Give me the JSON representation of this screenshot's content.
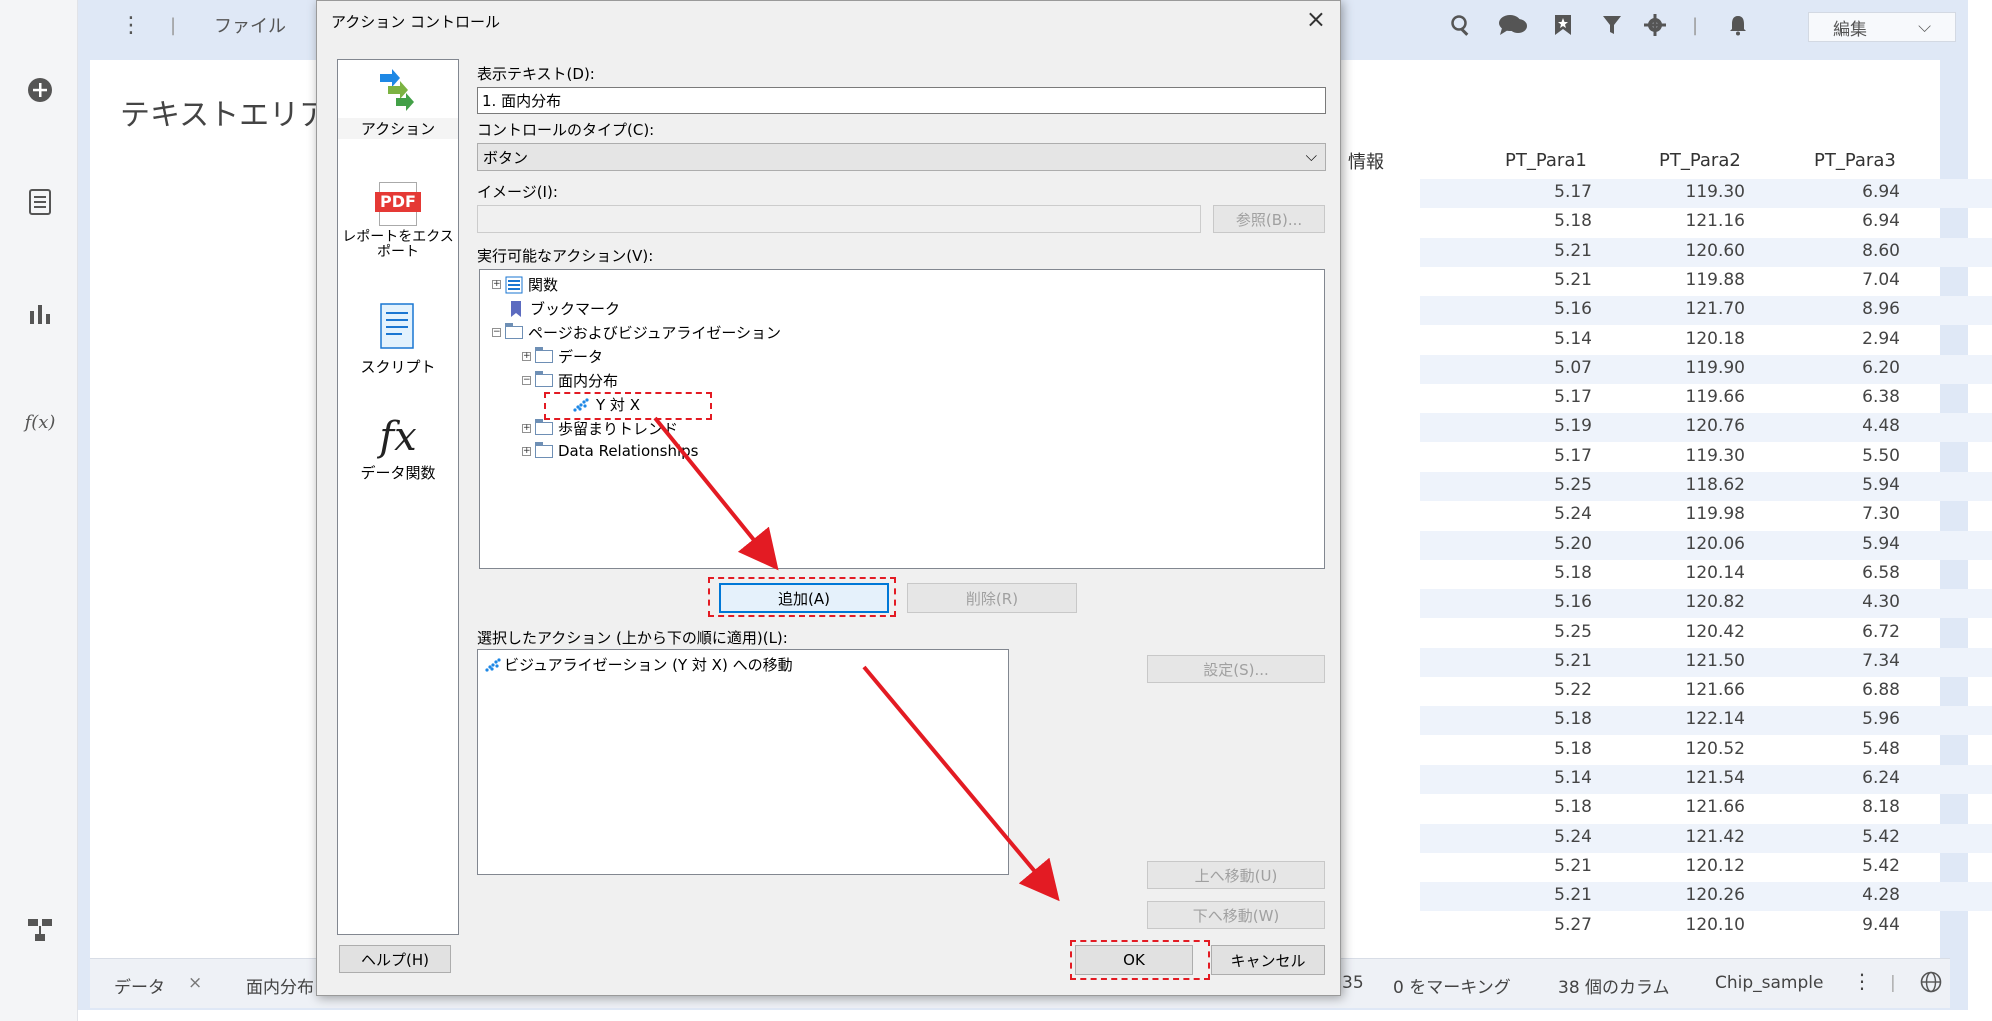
{
  "app": {
    "topbar": {
      "file_menu": "ファイル",
      "edit_select": "編集"
    },
    "content_title": "テキストエリア",
    "table": {
      "partial_header": "情報",
      "columns": [
        "PT_Para1",
        "PT_Para2",
        "PT_Para3"
      ],
      "rows": [
        [
          "5.17",
          "119.30",
          "6.94"
        ],
        [
          "5.18",
          "121.16",
          "6.94"
        ],
        [
          "5.21",
          "120.60",
          "8.60"
        ],
        [
          "5.21",
          "119.88",
          "7.04"
        ],
        [
          "5.16",
          "121.70",
          "8.96"
        ],
        [
          "5.14",
          "120.18",
          "2.94"
        ],
        [
          "5.07",
          "119.90",
          "6.20"
        ],
        [
          "5.17",
          "119.66",
          "6.38"
        ],
        [
          "5.19",
          "120.76",
          "4.48"
        ],
        [
          "5.17",
          "119.30",
          "5.50"
        ],
        [
          "5.25",
          "118.62",
          "5.94"
        ],
        [
          "5.24",
          "119.98",
          "7.30"
        ],
        [
          "5.20",
          "120.06",
          "5.94"
        ],
        [
          "5.18",
          "120.14",
          "6.58"
        ],
        [
          "5.16",
          "120.82",
          "4.30"
        ],
        [
          "5.25",
          "120.42",
          "6.72"
        ],
        [
          "5.21",
          "121.50",
          "7.34"
        ],
        [
          "5.22",
          "121.66",
          "6.88"
        ],
        [
          "5.18",
          "122.14",
          "5.96"
        ],
        [
          "5.18",
          "120.52",
          "5.48"
        ],
        [
          "5.14",
          "121.54",
          "6.24"
        ],
        [
          "5.18",
          "121.66",
          "8.18"
        ],
        [
          "5.24",
          "121.42",
          "5.42"
        ],
        [
          "5.21",
          "120.12",
          "5.42"
        ],
        [
          "5.21",
          "120.26",
          "4.28"
        ],
        [
          "5.27",
          "120.10",
          "9.44"
        ]
      ]
    },
    "bottombar": {
      "tab_data": "データ",
      "tab_close": "×",
      "tab_page": "面内分布",
      "row_count_partial": "35",
      "marking": "0 をマーキング",
      "columns": "38 個のカラム",
      "table_name": "Chip_sample"
    }
  },
  "dialog": {
    "title": "アクション コントロール",
    "close": "×",
    "nav": [
      {
        "label": "アクション"
      },
      {
        "label": "レポートをエクスポート"
      },
      {
        "label": "スクリプト"
      },
      {
        "label": "データ関数"
      }
    ],
    "pdf_icon_text": "PDF",
    "fx_icon_text": "fx",
    "display_text_label": "表示テキスト(D):",
    "display_text_value": "1. 面内分布",
    "control_type_label": "コントロールのタイプ(C):",
    "control_type_value": "ボタン",
    "image_label": "イメージ(I):",
    "browse_button": "参照(B)...",
    "available_actions_label": "実行可能なアクション(V):",
    "tree": {
      "functions": "関数",
      "bookmarks": "ブックマーク",
      "pages": "ページおよびビジュアライゼーション",
      "data": "データ",
      "wafer": "面内分布",
      "y_vs_x": "Y 対 X",
      "yield_trend": "歩留まりトレンド",
      "data_relationships": "Data Relationships"
    },
    "add_button": "追加(A)",
    "remove_button": "削除(R)",
    "selected_actions_label": "選択したアクション (上から下の順に適用)(L):",
    "selected_actions": [
      "ビジュアライゼーション (Y 対 X) への移動"
    ],
    "settings_button": "設定(S)...",
    "move_up_button": "上へ移動(U)",
    "move_down_button": "下へ移動(W)",
    "help_button": "ヘルプ(H)",
    "ok_button": "OK",
    "cancel_button": "キャンセル"
  },
  "colors": {
    "annotation_red": "#e31b23",
    "frame_blue": "#dfe8f6",
    "row_band": "#eef3fb"
  }
}
